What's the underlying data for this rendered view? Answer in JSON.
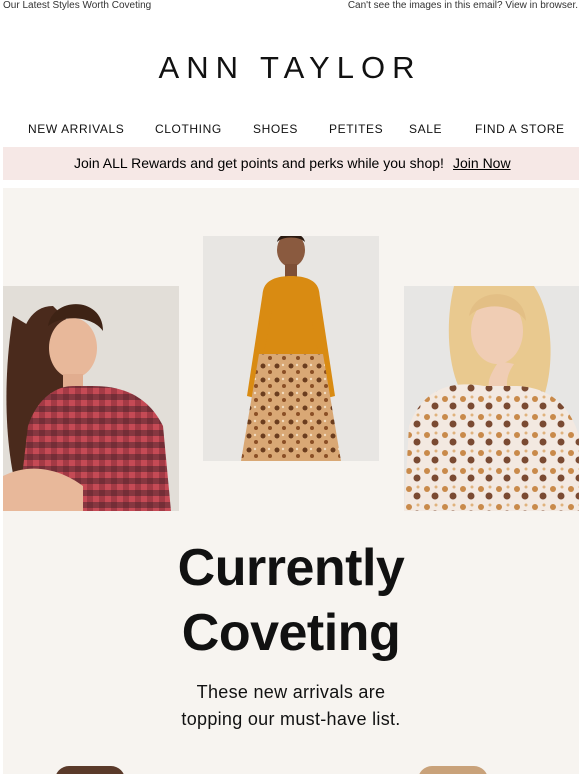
{
  "preheader": {
    "left_text": "Our Latest Styles Worth Coveting",
    "right_text": "Can't see the images in this email? View in browser."
  },
  "brand": {
    "logo_text": "ANN TAYLOR"
  },
  "nav": {
    "items": [
      "NEW ARRIVALS",
      "CLOTHING",
      "SHOES",
      "PETITES",
      "SALE",
      "FIND A STORE"
    ]
  },
  "rewards": {
    "message": "Join ALL Rewards and get points and perks while you shop!",
    "link_label": "Join Now",
    "background": "#f6e8e6"
  },
  "hero": {
    "background": "#f7f4f0",
    "headline_line1": "Currently",
    "headline_line2": "Coveting",
    "subhead_line1": "These new arrivals are",
    "subhead_line2": "topping our must-have list.",
    "photos": [
      {
        "subject": "model in red plaid shirt"
      },
      {
        "subject": "model in mustard top and leopard skirt"
      },
      {
        "subject": "model in floral print blouse"
      }
    ]
  }
}
